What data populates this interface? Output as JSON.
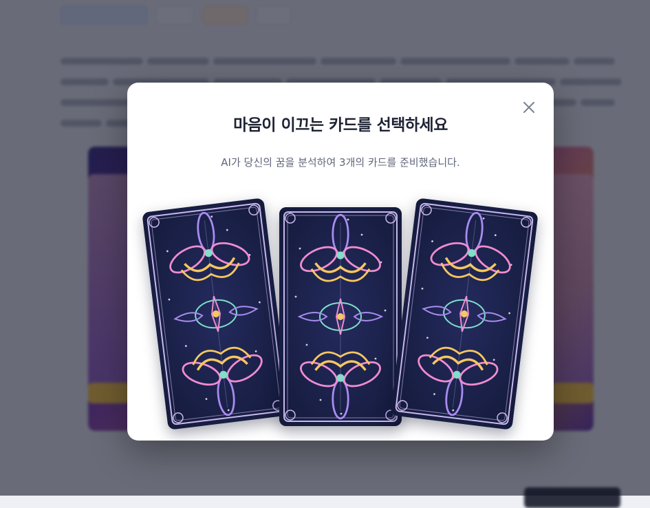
{
  "modal": {
    "title": "마음이 이끄는 카드를 선택하세요",
    "subtitle": "AI가 당신의 꿈을 분석하여 3개의 카드를 준비했습니다.",
    "close_icon": "close-icon"
  },
  "cards": [
    {
      "icon": "tarot-card-back",
      "tilt": "left"
    },
    {
      "icon": "tarot-card-back",
      "tilt": "none"
    },
    {
      "icon": "tarot-card-back",
      "tilt": "right"
    }
  ],
  "colors": {
    "card_background": "#141a3a",
    "card_border": "#c9b9ee",
    "ornament_pink": "#f08cd0",
    "ornament_gold": "#f6c85f",
    "ornament_teal": "#7ee0c8",
    "ornament_violet": "#a98cf0",
    "overlay": "rgba(16,20,36,0.6)"
  }
}
